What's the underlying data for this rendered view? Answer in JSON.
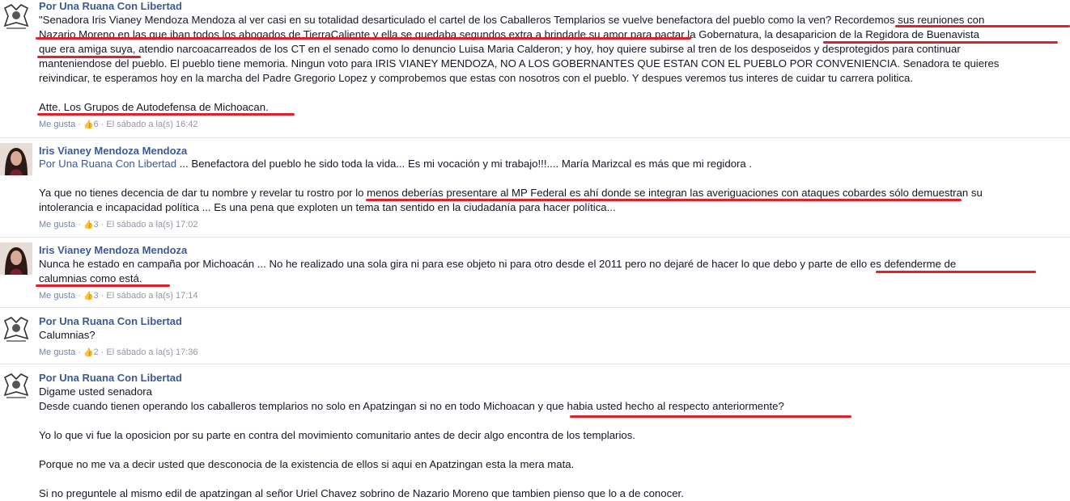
{
  "comments": [
    {
      "author": "Por Una Ruana Con Libertad",
      "lines": [
        "\"Senadora Iris Vianey Mendoza Mendoza al ver casi en su totalidad desarticulado el cartel de los Caballeros Templarios se vuelve benefactora del pueblo como la ven? Recordemos sus reuniones con",
        "Nazario Moreno en las que iban todos los abogados de TierraCaliente y ella se quedaba segundos extra a brindarle su amor para pactar la Gobernatura, la desaparicion de la Regidora de Buenavista",
        "que era amiga suya, atendio narcoacarreados de los CT en el senado como lo denuncio Luisa Maria Calderon; y hoy, hoy quiere subirse al tren de los desposeidos y desprotegidos para continuar",
        "manteniendose del pueblo. El pueblo tiene memoria. Ningun voto para IRIS VIANEY MENDOZA, NO A LOS GOBERNANTES QUE ESTAN CON EL PUEBLO POR CONVENIENCIA. Senadora te quieres",
        "reivindicar, te esperamos hoy en la marcha del Padre Gregorio Lopez y comprobemos que estas con nosotros con el pueblo. Y despues veremos tus interes de cuidar tu carrera politica.",
        "Atte. Los Grupos de Autodefensa de Michoacan."
      ],
      "like_label": "Me gusta",
      "likes": "6",
      "time": "El sábado a la(s) 16:42"
    },
    {
      "author": "Iris Vianey Mendoza Mendoza",
      "tag": "Por Una Ruana Con Libertad",
      "lines": [
        " ... Benefactora del pueblo he sido toda la vida... Es mi vocación y mi trabajo!!!.... María Marizcal es más que mi regidora .",
        "Ya que no tienes decencia de dar tu nombre y revelar tu rostro por lo menos deberías presentare al MP Federal es ahí donde se integran las averiguaciones con ataques cobardes sólo demuestran su",
        "intolerancia e incapacidad política ... Es una pena que exploten un tema tan sentido en la ciudadanía para hacer política..."
      ],
      "like_label": "Me gusta",
      "likes": "3",
      "time": "El sábado a la(s) 17:02"
    },
    {
      "author": "Iris Vianey Mendoza Mendoza",
      "lines": [
        "Nunca he estado en campaña por Michoacán ... No he realizado una sola gira ni para ese objeto ni para otro desde el 2011 pero no dejaré de hacer lo que debo y parte de ello es defenderme de",
        "calumnias como está."
      ],
      "like_label": "Me gusta",
      "likes": "3",
      "time": "El sábado a la(s) 17:14"
    },
    {
      "author": "Por Una Ruana Con Libertad",
      "lines": [
        "Calumnias?"
      ],
      "like_label": "Me gusta",
      "likes": "2",
      "time": "El sábado a la(s) 17:36"
    },
    {
      "author": "Por Una Ruana Con Libertad",
      "lines": [
        "Digame usted senadora",
        "Desde cuando tienen operando los caballeros templarios no solo en Apatzingan si no en todo Michoacan y que habia usted hecho al respecto anteriormente?",
        "Yo lo que vi fue la oposicion por su parte en contra del movimiento comunitario antes de decir algo encontra de los templarios.",
        "Porque no me va a decir usted que desconocia de la existencia de ellos si aqui en Apatzingan esta la mera mata.",
        "Si no preguntele al mismo edil de apatzingan al señor Uriel Chavez sobrino de Nazario Moreno que tambien pienso que lo a de conocer."
      ]
    }
  ],
  "separator": " · ",
  "colors": {
    "link": "#3b5998",
    "underline": "#e0202a",
    "meta": "#9197a3"
  }
}
